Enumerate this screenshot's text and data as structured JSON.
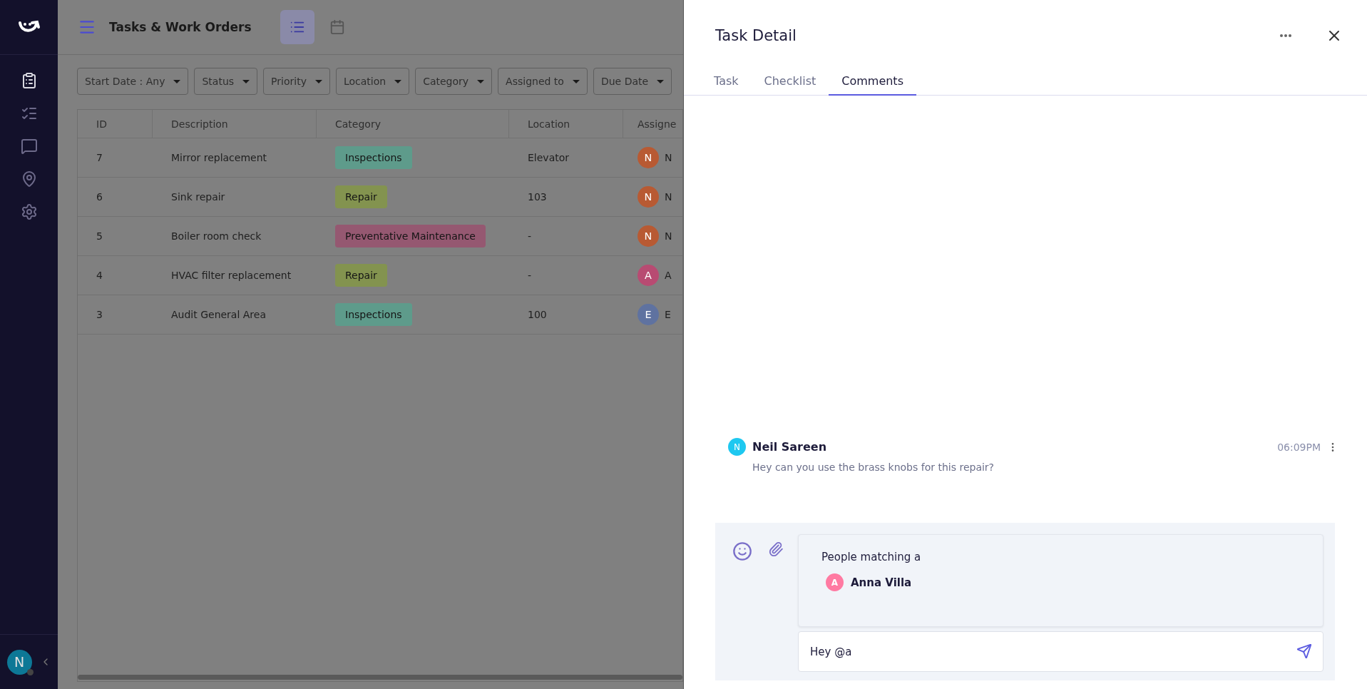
{
  "app": {
    "title": "Tasks & Work Orders",
    "views": [
      {
        "kind": "list",
        "selected": true
      },
      {
        "kind": "calendar",
        "selected": false
      }
    ]
  },
  "nav": [
    {
      "kind": "clipboard",
      "selected": true
    },
    {
      "kind": "checklist",
      "selected": false
    },
    {
      "kind": "chat",
      "selected": false
    },
    {
      "kind": "location",
      "selected": false
    },
    {
      "kind": "settings",
      "selected": false
    }
  ],
  "user": {
    "initial": "N"
  },
  "filters": [
    "Start Date : Any",
    "Status",
    "Priority",
    "Location",
    "Category",
    "Assigned to",
    "Due Date"
  ],
  "table": {
    "columns": [
      "ID",
      "Description",
      "Category",
      "Location",
      "Assigne"
    ],
    "rows": [
      {
        "id": "7",
        "description": "Mirror replacement",
        "category": {
          "label": "Inspections",
          "color": "#5e9b8b"
        },
        "location": "Elevator",
        "assignee": {
          "initial": "N",
          "color": "#b85a33",
          "name": "N"
        }
      },
      {
        "id": "6",
        "description": "Sink repair",
        "category": {
          "label": "Repair",
          "color": "#83934f"
        },
        "location": "103",
        "assignee": {
          "initial": "N",
          "color": "#b85a33",
          "name": "N"
        }
      },
      {
        "id": "5",
        "description": "Boiler room check",
        "category": {
          "label": "Preventative Maintenance",
          "color": "#955871"
        },
        "location": "-",
        "assignee": {
          "initial": "N",
          "color": "#b85a33",
          "name": "N"
        }
      },
      {
        "id": "4",
        "description": "HVAC filter replacement",
        "category": {
          "label": "Repair",
          "color": "#83934f"
        },
        "location": "-",
        "assignee": {
          "initial": "A",
          "color": "#b84b72",
          "name": "A"
        }
      },
      {
        "id": "3",
        "description": "Audit General Area",
        "category": {
          "label": "Inspections",
          "color": "#5e9b8b"
        },
        "location": "100",
        "assignee": {
          "initial": "E",
          "color": "#5f72a0",
          "name": "E"
        }
      }
    ]
  },
  "panel": {
    "title": "Task Detail",
    "tabs": [
      {
        "label": "Task",
        "selected": false
      },
      {
        "label": "Checklist",
        "selected": false
      },
      {
        "label": "Comments",
        "selected": true
      }
    ],
    "comments": [
      {
        "author": "Neil Sareen",
        "initial": "N",
        "color": "#1ec8f0",
        "time": "06:09PM",
        "text": "Hey can you use the brass knobs for this repair?"
      }
    ],
    "mentions": {
      "title": "People matching a",
      "people": [
        {
          "name": "Anna Villa",
          "initial": "A",
          "color": "#ff7aa2"
        }
      ]
    },
    "composer": {
      "value": "Hey @a"
    }
  }
}
